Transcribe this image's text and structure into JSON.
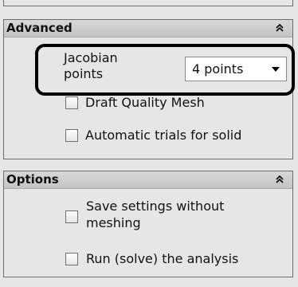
{
  "advanced": {
    "title": "Advanced",
    "jacobian_label": "Jacobian\npoints",
    "jacobian_value": "4 points",
    "draft_quality_label": "Draft Quality Mesh",
    "automatic_trials_label": "Automatic trials for solid",
    "draft_quality_checked": false,
    "automatic_trials_checked": false
  },
  "options": {
    "title": "Options",
    "save_settings_line1": "Save settings without",
    "save_settings_line2": "meshing",
    "run_analysis_label": "Run (solve) the analysis",
    "save_settings_checked": false,
    "run_analysis_checked": false
  },
  "icons": {
    "collapse": "double-chevron-up-icon",
    "dropdown": "dropdown-arrow-icon"
  },
  "colors": {
    "panel_background": "#e6e6e6",
    "header_background": "#cccccc",
    "highlight_border": "#000000"
  }
}
